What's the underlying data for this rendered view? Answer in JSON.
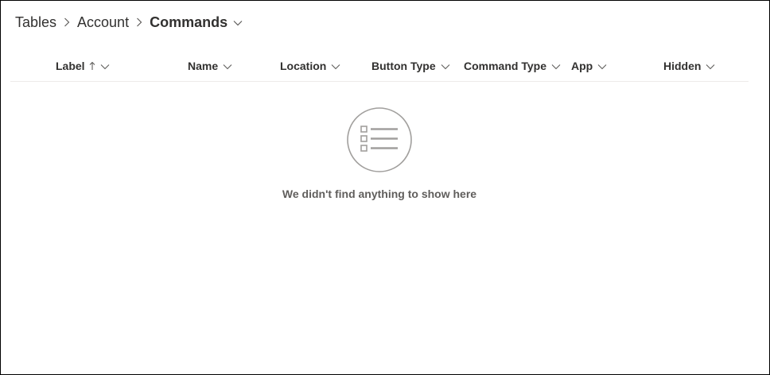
{
  "breadcrumb": {
    "items": [
      "Tables",
      "Account"
    ],
    "current": "Commands"
  },
  "table": {
    "columns": [
      {
        "label": "Label",
        "sorted": "ascending"
      },
      {
        "label": "Name"
      },
      {
        "label": "Location"
      },
      {
        "label": "Button Type"
      },
      {
        "label": "Command Type"
      },
      {
        "label": "App"
      },
      {
        "label": "Hidden"
      }
    ]
  },
  "empty_state": {
    "icon": "list-icon",
    "message": "We didn't find anything to show here"
  },
  "colors": {
    "text": "#323130",
    "muted": "#605e5c",
    "icon_gray": "#a19f9d",
    "divider": "#edebe9"
  }
}
